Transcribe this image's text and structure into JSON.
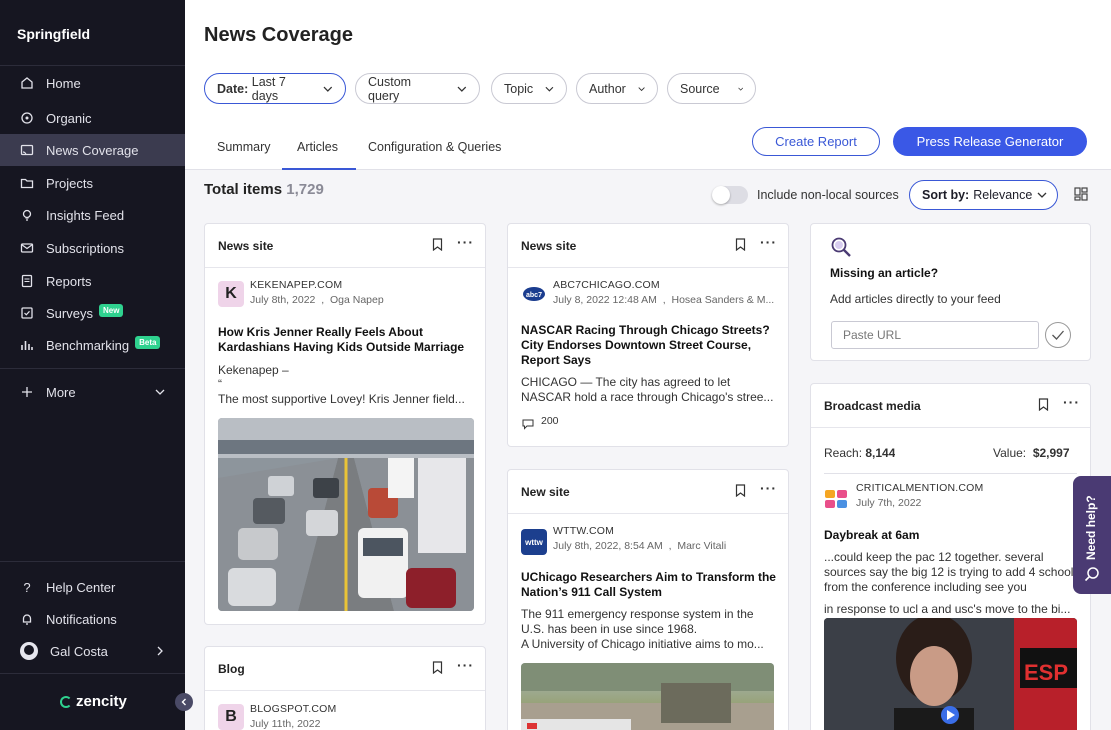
{
  "brand": "Springfield",
  "sidebar": {
    "items": [
      {
        "label": "Home",
        "icon": "home-icon"
      },
      {
        "label": "Organic",
        "icon": "organic-icon"
      },
      {
        "label": "News Coverage",
        "icon": "news-icon",
        "active": true
      },
      {
        "label": "Projects",
        "icon": "folder-icon"
      },
      {
        "label": "Insights Feed",
        "icon": "bulb-icon"
      },
      {
        "label": "Subscriptions",
        "icon": "mail-icon"
      },
      {
        "label": "Reports",
        "icon": "report-icon"
      },
      {
        "label": "Surveys",
        "icon": "survey-icon",
        "badge": "New"
      },
      {
        "label": "Benchmarking",
        "icon": "chart-icon",
        "badge": "Beta"
      }
    ],
    "more": "More",
    "help": "Help Center",
    "notifications": "Notifications",
    "user": "Gal Costa",
    "logo": "zencity",
    "badge_color": "#2fd28f"
  },
  "header": {
    "title": "News Coverage",
    "filters": {
      "date_key": "Date:",
      "date_value": "Last 7 days",
      "custom": "Custom query",
      "topic": "Topic",
      "author": "Author",
      "source": "Source"
    },
    "tabs": [
      "Summary",
      "Articles",
      "Configuration & Queries"
    ],
    "create_report": "Create Report",
    "press_release": "Press Release Generator",
    "accent": "#3a58d6"
  },
  "toolbar": {
    "total_label": "Total items",
    "total_count": "1,729",
    "toggle_label": "Include non-local sources",
    "sort_key": "Sort by:",
    "sort_value": "Relevance"
  },
  "cards": {
    "c1": {
      "type": "News site",
      "source_initial": "K",
      "source": "KEKENAPEP.COM",
      "date": "July 8th, 2022",
      "author": "Oga Napep",
      "headline": "How Kris Jenner Really Feels About Kardashians Having Kids Outside Marriage",
      "line1": "Kekenapep –",
      "line2": "“",
      "line3": "The most supportive Lovey! Kris Jenner field..."
    },
    "c2": {
      "type": "News site",
      "source": "ABC7CHICAGO.COM",
      "date": "July 8, 2022 12:48 AM",
      "author": "Hosea Sanders & M...",
      "headline": "NASCAR Racing Through Chicago Streets? City Endorses Downtown Street Course, Report Says",
      "body": "CHICAGO — The city has agreed to let NASCAR hold a race through Chicago's stree...",
      "comments": "200"
    },
    "c3": {
      "type": "New site",
      "source_logo": "wttw",
      "source": "WTTW.COM",
      "date": "July 8th, 2022, 8:54 AM",
      "author": "Marc Vitali",
      "headline": "UChicago Researchers Aim to Transform the Nation’s 911 Call System",
      "body1": "The 911 emergency response system in the U.S. has been in use since 1968.",
      "body2": "A University of Chicago initiative aims to mo..."
    },
    "c4": {
      "type": "Blog",
      "source_initial": "B",
      "source": "BLOGSPOT.COM",
      "date": "July 11th, 2022"
    },
    "missing": {
      "title": "Missing an article?",
      "desc": "Add articles directly to your feed",
      "placeholder": "Paste URL"
    },
    "broadcast": {
      "type": "Broadcast media",
      "reach_label": "Reach:",
      "reach": "8,144",
      "value_label": "Value:",
      "value": "$2,997",
      "source": "CRITICALMENTION.COM",
      "date": "July 7th, 2022",
      "headline": "Daybreak at 6am",
      "body": "...could keep the pac 12 together. several sources say the big 12 is trying to add 4 schools from the conference including see you",
      "body2": "in response to ucl a and usc's move to the bi..."
    }
  },
  "help_tab": "Need help?"
}
